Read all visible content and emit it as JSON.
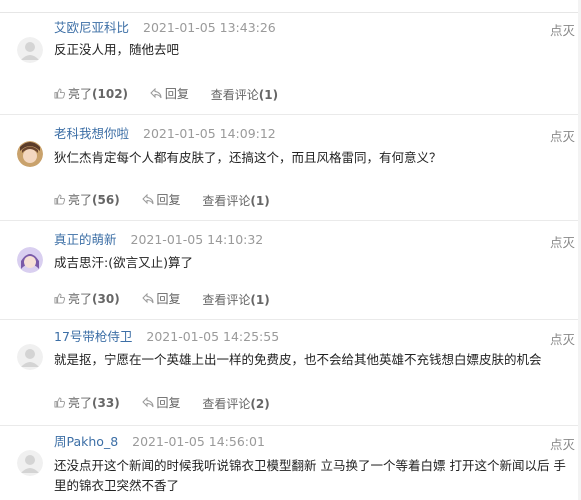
{
  "comments": [
    {
      "user": "艾欧尼亚科比",
      "time": "2021-01-05 13:43:26",
      "text": "反正没人用，随他去吧",
      "like_label": "亮了",
      "like_count": "(102)",
      "reply_label": "回复",
      "view_label": "查看评论",
      "view_count": "(1)",
      "extinguish": "点灭",
      "avatar_icon": "default-user-avatar-icon"
    },
    {
      "user": "老科我想你啦",
      "time": "2021-01-05 14:09:12",
      "text": "狄仁杰肯定每个人都有皮肤了，还搞这个，而且风格雷同，有何意义？",
      "like_label": "亮了",
      "like_count": "(56)",
      "reply_label": "回复",
      "view_label": "查看评论",
      "view_count": "(1)",
      "extinguish": "点灭",
      "avatar_icon": "anime-character-avatar-icon"
    },
    {
      "user": "真正的萌新",
      "time": "2021-01-05 14:10:32",
      "text": "成吉思汗:(欲言又止)算了",
      "like_label": "亮了",
      "like_count": "(30)",
      "reply_label": "回复",
      "view_label": "查看评论",
      "view_count": "(1)",
      "extinguish": "点灭",
      "avatar_icon": "anime-character-avatar-icon"
    },
    {
      "user": "17号带枪侍卫",
      "time": "2021-01-05 14:25:55",
      "text": "就是抠，宁愿在一个英雄上出一样的免费皮，也不会给其他英雄不充钱想白嫖皮肤的机会",
      "like_label": "亮了",
      "like_count": "(33)",
      "reply_label": "回复",
      "view_label": "查看评论",
      "view_count": "(2)",
      "extinguish": "点灭",
      "avatar_icon": "default-user-avatar-icon"
    },
    {
      "user": "周Pakho_8",
      "time": "2021-01-05 14:56:01",
      "text": "还没点开这个新闻的时候我听说锦衣卫模型翻新 立马换了一个等着白嫖 打开这个新闻以后 手里的锦衣卫突然不香了",
      "extinguish": "点灭",
      "avatar_icon": "default-user-avatar-icon"
    }
  ]
}
